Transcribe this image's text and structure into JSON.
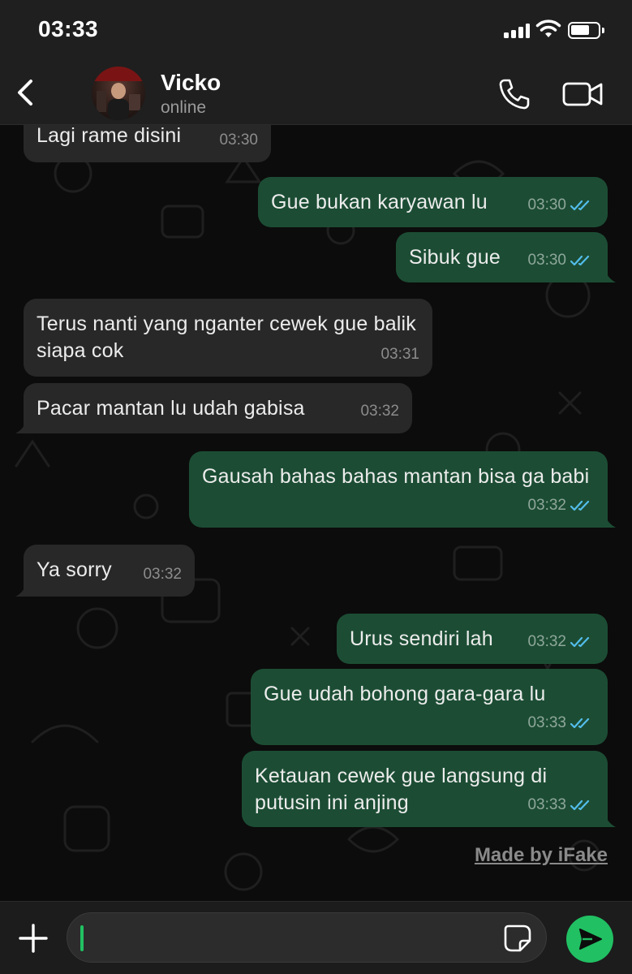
{
  "status_bar": {
    "time": "03:33"
  },
  "header": {
    "contact_name": "Vicko",
    "contact_status": "online"
  },
  "messages": [
    {
      "direction": "in",
      "text": "Lagi rame disini",
      "time": "03:30"
    },
    {
      "direction": "out",
      "text": "Gue bukan karyawan lu",
      "time": "03:30",
      "read": true
    },
    {
      "direction": "out",
      "text": "Sibuk gue",
      "time": "03:30",
      "read": true
    },
    {
      "direction": "in",
      "text": "Terus nanti yang nganter cewek gue balik siapa cok",
      "time": "03:31"
    },
    {
      "direction": "in",
      "text": "Pacar mantan lu udah gabisa",
      "time": "03:32"
    },
    {
      "direction": "out",
      "text": "Gausah bahas bahas mantan bisa ga babi",
      "time": "03:32",
      "read": true
    },
    {
      "direction": "in",
      "text": "Ya sorry",
      "time": "03:32"
    },
    {
      "direction": "out",
      "text": "Urus sendiri lah",
      "time": "03:32",
      "read": true
    },
    {
      "direction": "out",
      "text": "Gue udah bohong gara-gara lu",
      "time": "03:33",
      "read": true
    },
    {
      "direction": "out",
      "text": "Ketauan cewek gue langsung di putusin ini anjing",
      "time": "03:33",
      "read": true
    }
  ],
  "watermark": "Made by iFake",
  "colors": {
    "incoming_bubble": "#282828",
    "outgoing_bubble": "#1c4d34",
    "read_ticks": "#53bdeb",
    "accent_green": "#21c063"
  },
  "icons": {
    "back": "chevron-left-icon",
    "call": "phone-icon",
    "video": "video-camera-icon",
    "attach": "plus-icon",
    "sticker": "sticker-icon",
    "send": "send-icon"
  }
}
